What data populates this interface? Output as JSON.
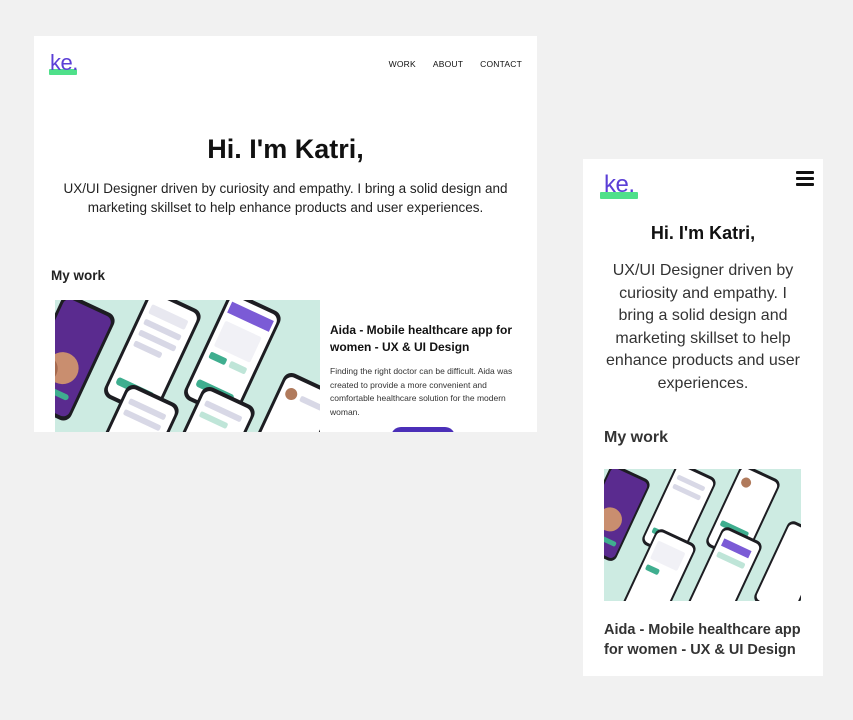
{
  "desktop": {
    "logo": "ke.",
    "nav": [
      "WORK",
      "ABOUT",
      "CONTACT"
    ],
    "hero": {
      "title": "Hi. I'm Katri,",
      "subtitle": "UX/UI Designer driven by curiosity and empathy. I bring a solid design and marketing skillset to help enhance products and user experiences."
    },
    "section_title": "My work",
    "project": {
      "title": "Aida - Mobile healthcare app for women - UX & UI Design",
      "description": "Finding the right doctor can be difficult. Aida was created to provide a more convenient and comfortable healthcare solution for the modern woman.",
      "image_icon": "app-mockup-image"
    }
  },
  "mobile": {
    "logo": "ke.",
    "menu_icon": "hamburger-icon",
    "hero": {
      "title": "Hi. I'm Katri,",
      "subtitle": "UX/UI Designer driven by curiosity and empathy. I bring a solid design and marketing skillset to help enhance products and user experiences."
    },
    "section_title": "My work",
    "project": {
      "title": "Aida - Mobile healthcare app for women - UX & UI Design",
      "image_icon": "app-mockup-image"
    }
  },
  "colors": {
    "background": "#f1f1f1",
    "logo": "#5b3fd6",
    "logo_highlight": "#4fe08a",
    "accent_purple": "#4b2fb8",
    "mockup_bg": "#cfece3"
  }
}
